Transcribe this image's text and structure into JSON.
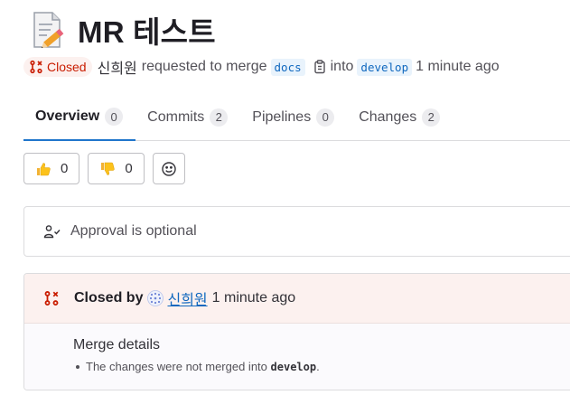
{
  "mr": {
    "title_emoji": "memo-emoji",
    "title": "MR 테스트",
    "status": "Closed",
    "author": "신희원",
    "requested_text": "requested to merge",
    "source_branch": "docs",
    "into_text": "into",
    "target_branch": "develop",
    "time": "1 minute ago"
  },
  "tabs": [
    {
      "label": "Overview",
      "count": "0"
    },
    {
      "label": "Commits",
      "count": "2"
    },
    {
      "label": "Pipelines",
      "count": "0"
    },
    {
      "label": "Changes",
      "count": "2"
    }
  ],
  "reactions": {
    "thumbs_up": "0",
    "thumbs_down": "0"
  },
  "approval": {
    "text": "Approval is optional"
  },
  "closed_widget": {
    "closed_by": "Closed by",
    "user": "신희원",
    "time": "1 minute ago",
    "details_title": "Merge details",
    "details_prefix": "The changes were not merged into",
    "details_branch": "develop",
    "details_suffix": "."
  },
  "colors": {
    "accent": "#1f75cb",
    "closed_red": "#c91c00",
    "closed_bg": "#fcf1ef",
    "link": "#1068bf"
  }
}
